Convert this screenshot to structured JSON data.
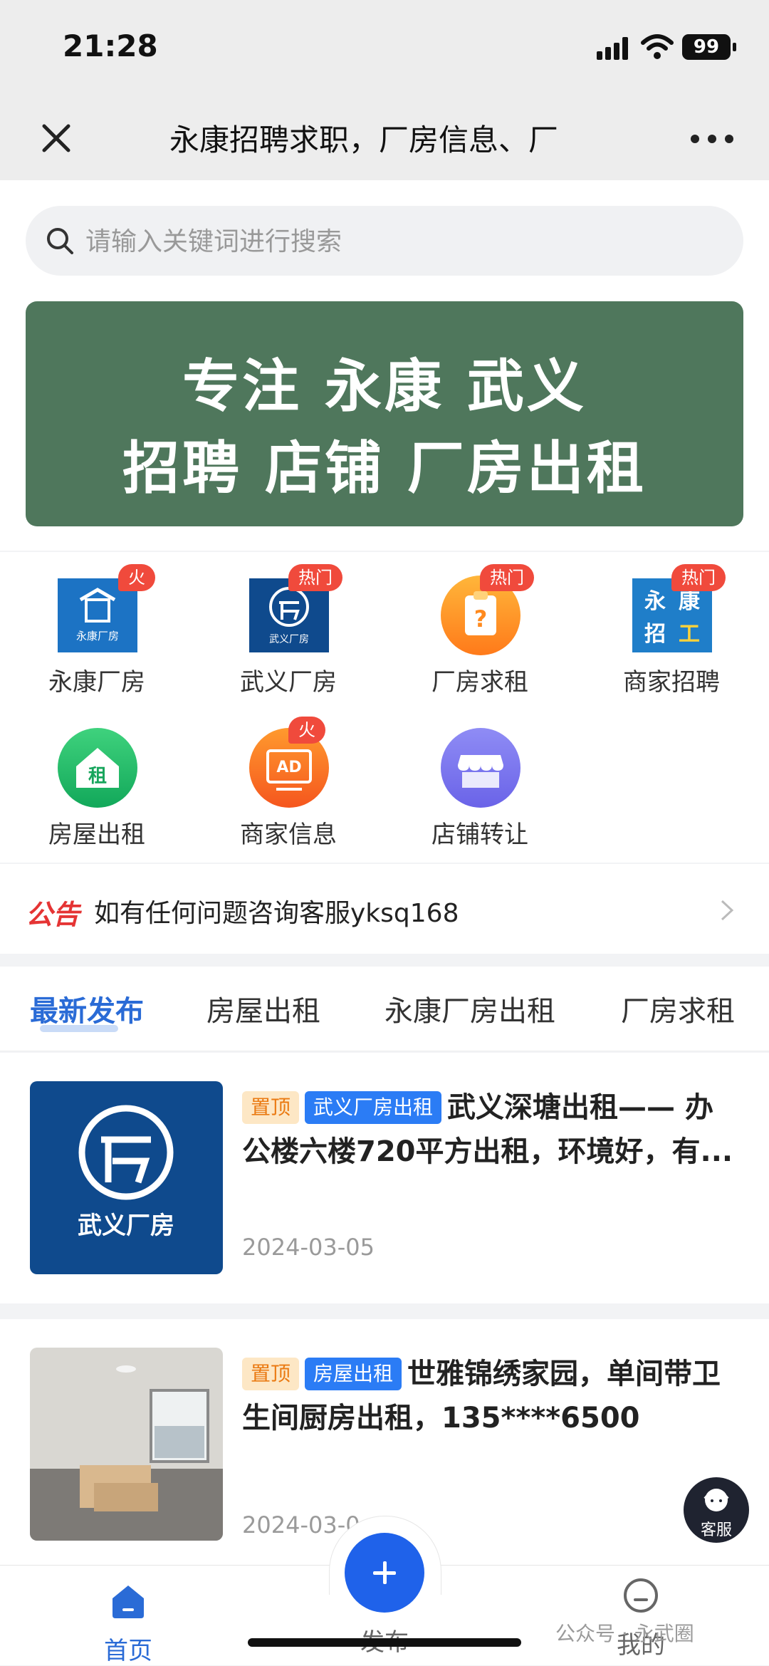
{
  "status": {
    "time": "21:28",
    "battery": "99"
  },
  "nav": {
    "title": "永康招聘求职，厂房信息、厂"
  },
  "search": {
    "placeholder": "请输入关键词进行搜索"
  },
  "banner": {
    "line1": "专注 永康 武义",
    "line2": "招聘 店铺 厂房出租"
  },
  "categories": [
    {
      "label": "永康厂房",
      "tag": "火",
      "icon": "yongkang-factory-icon",
      "icon_text": "永康厂房"
    },
    {
      "label": "武义厂房",
      "tag": "热门",
      "icon": "wuyi-factory-icon",
      "icon_text": "武义厂房"
    },
    {
      "label": "厂房求租",
      "tag": "热门",
      "icon": "clipboard-question-icon"
    },
    {
      "label": "商家招聘",
      "tag": "热门",
      "icon": "recruit-icon",
      "icon_chars": [
        "永",
        "康",
        "招",
        "工"
      ]
    },
    {
      "label": "房屋出租",
      "tag": "",
      "icon": "house-rent-icon",
      "icon_text": "租"
    },
    {
      "label": "商家信息",
      "tag": "火",
      "icon": "ad-icon",
      "icon_text": "AD"
    },
    {
      "label": "店铺转让",
      "tag": "",
      "icon": "storefront-icon"
    }
  ],
  "notice": {
    "badge": "公告",
    "text": "如有任何问题咨询客服yksq168"
  },
  "tabs": [
    "最新发布",
    "房屋出租",
    "永康厂房出租",
    "厂房求租"
  ],
  "posts": [
    {
      "pin": "置顶",
      "category": "武义厂房出租",
      "title": "武义深塘出租—— 办公楼六楼720平方出租，环境好，有...",
      "date": "2024-03-05",
      "thumb_text": "武义厂房"
    },
    {
      "pin": "置顶",
      "category": "房屋出租",
      "title": "世雅锦绣家园，单间带卫生间厨房出租，135****6500",
      "date": "2024-03-0"
    }
  ],
  "kefu": {
    "label": "客服"
  },
  "tabbar": {
    "home": "首页",
    "publish": "发布",
    "mine": "我的"
  },
  "watermark": "公众号 · 永武圈",
  "colors": {
    "accent": "#2a6bd6",
    "banner": "#4f775c",
    "hot_tag": "#f04a3c",
    "notice": "#e53434"
  }
}
